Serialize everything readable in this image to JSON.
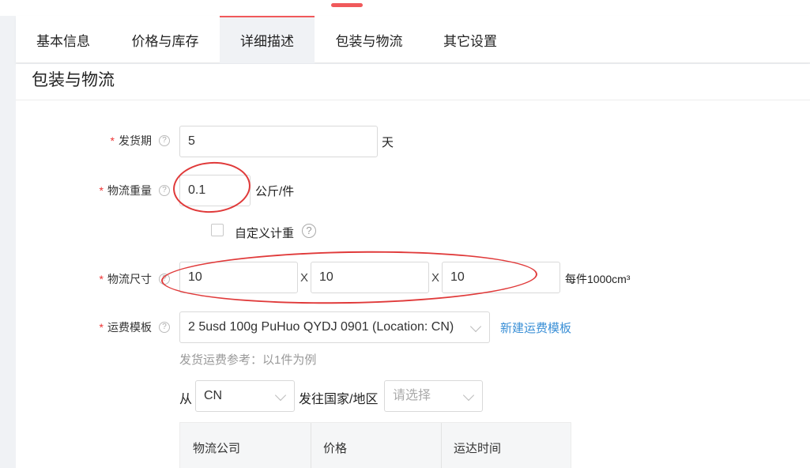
{
  "tabs": [
    {
      "label": "基本信息"
    },
    {
      "label": "价格与库存"
    },
    {
      "label": "详细描述"
    },
    {
      "label": "包装与物流"
    },
    {
      "label": "其它设置"
    }
  ],
  "active_tab": "详细描述",
  "section": {
    "title": "包装与物流"
  },
  "form": {
    "required_mark": "*",
    "help_glyph": "?",
    "delivery": {
      "label": "发货期",
      "value": "5",
      "unit": "天"
    },
    "weight": {
      "label": "物流重量",
      "value": "0.1",
      "unit": "公斤/件"
    },
    "custom_weight": {
      "label": "自定义计重",
      "checked": false
    },
    "dimensions": {
      "label": "物流尺寸",
      "length": "10",
      "width": "10",
      "height": "10",
      "separator": "X",
      "unit": "每件1000cm³"
    },
    "template": {
      "label": "运费模板",
      "value": "2 5usd 100g PuHuo QYDJ 0901 (Location: CN)",
      "new_link": "新建运费模板"
    },
    "shipping_reference": {
      "hint": "发货运费参考：以1件为例",
      "from_label": "从",
      "from_value": "CN",
      "to_label": "发往国家/地区",
      "to_placeholder": "请选择"
    },
    "shipping_table": {
      "columns": [
        "物流公司",
        "价格",
        "运达时间"
      ]
    }
  },
  "colors": {
    "accent": "#f0595b",
    "required": "#e33333",
    "link": "#3a8fd6",
    "annotation": "#e03a3a"
  }
}
